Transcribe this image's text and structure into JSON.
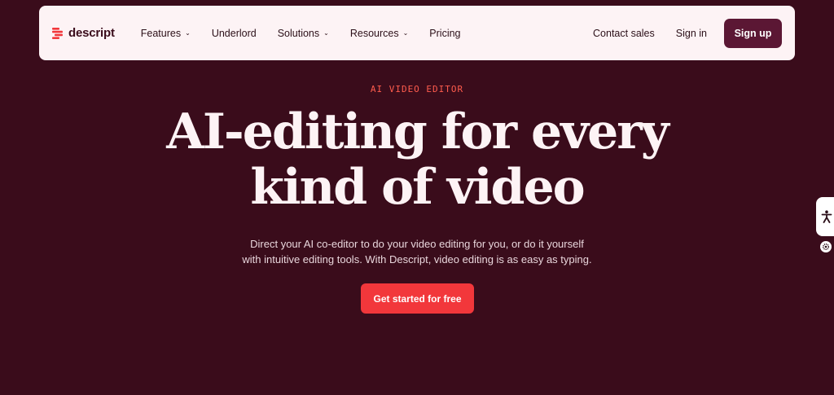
{
  "brand": {
    "name": "descript",
    "color": "#f2373b"
  },
  "nav": {
    "items": [
      {
        "label": "Features",
        "has_dropdown": true
      },
      {
        "label": "Underlord",
        "has_dropdown": false
      },
      {
        "label": "Solutions",
        "has_dropdown": true
      },
      {
        "label": "Resources",
        "has_dropdown": true
      },
      {
        "label": "Pricing",
        "has_dropdown": false
      }
    ],
    "contact_sales": "Contact sales",
    "sign_in": "Sign in",
    "sign_up": "Sign up",
    "chevron_icon": "chevron-down-icon"
  },
  "hero": {
    "eyebrow": "AI VIDEO EDITOR",
    "headline_line1": "AI-editing for every",
    "headline_line2": "kind of video",
    "subtext_line1": "Direct your AI co-editor to do your video editing for you, or do it yourself",
    "subtext_line2": "with intuitive editing tools. With Descript, video editing is as easy as typing.",
    "cta": "Get started for free"
  },
  "side_widget": {
    "accessibility_icon": "accessibility-person-icon",
    "settings_icon": "gear-icon"
  },
  "colors": {
    "background": "#3a0c1b",
    "nav_background": "#fdf3f5",
    "signup_button": "#5b1734",
    "cta_button": "#f2373b",
    "eyebrow": "#ff5c4d"
  }
}
